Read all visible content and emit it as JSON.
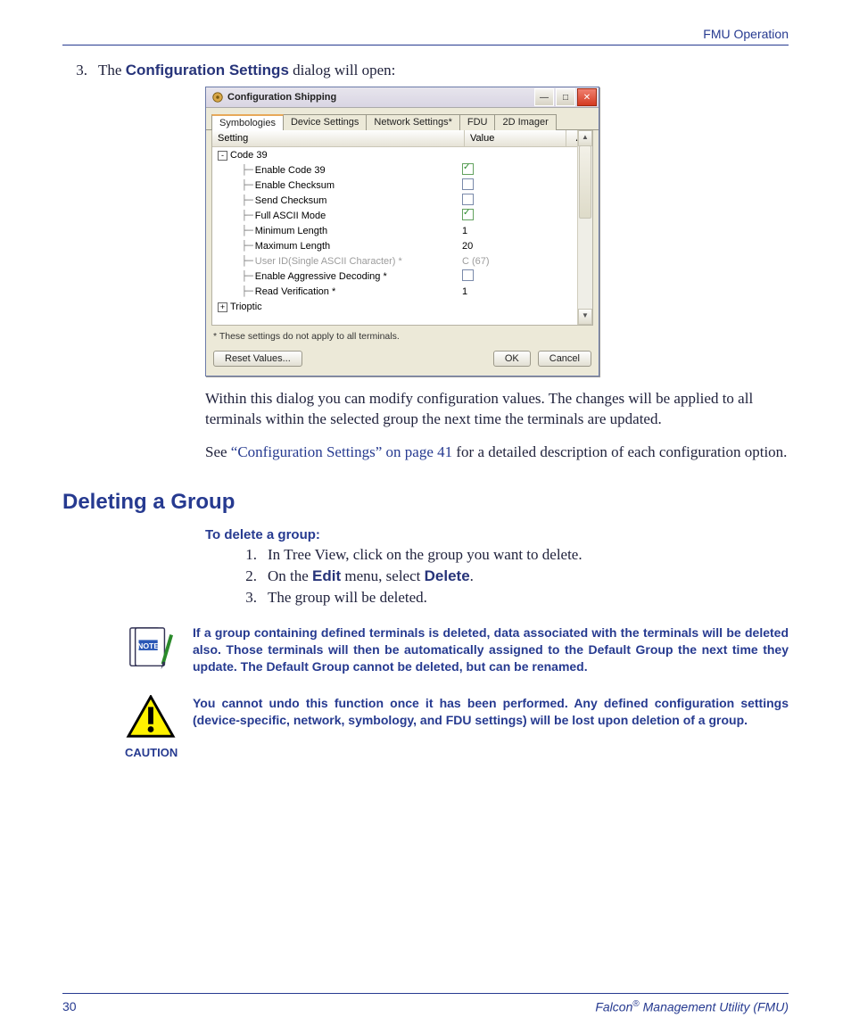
{
  "header": {
    "section": "FMU Operation"
  },
  "intro": {
    "step_num": "3.",
    "step_text_pre": "The ",
    "step_bold": "Configuration Settings",
    "step_text_post": " dialog will open:"
  },
  "dialog": {
    "title": "Configuration Shipping",
    "tabs": [
      "Symbologies",
      "Device Settings",
      "Network Settings*",
      "FDU",
      "2D Imager"
    ],
    "active_tab": 0,
    "columns": {
      "setting": "Setting",
      "value": "Value",
      "scrollhead": "▲"
    },
    "rows": [
      {
        "label": "Code 39",
        "indent": 0,
        "expander": "-",
        "value": ""
      },
      {
        "label": "Enable Code 39",
        "indent": 1,
        "value": "check-on"
      },
      {
        "label": "Enable Checksum",
        "indent": 1,
        "value": "check-off"
      },
      {
        "label": "Send Checksum",
        "indent": 1,
        "value": "check-off"
      },
      {
        "label": "Full ASCII Mode",
        "indent": 1,
        "value": "check-on"
      },
      {
        "label": "Minimum Length",
        "indent": 1,
        "value": "1"
      },
      {
        "label": "Maximum Length",
        "indent": 1,
        "value": "20"
      },
      {
        "label": "User ID(Single ASCII Character) *",
        "indent": 1,
        "value": "C (67)",
        "disabled": true
      },
      {
        "label": "Enable Aggressive Decoding *",
        "indent": 1,
        "value": "check-off"
      },
      {
        "label": "Read Verification *",
        "indent": 1,
        "value": "1"
      },
      {
        "label": "Trioptic",
        "indent": 0,
        "expander": "+",
        "value": ""
      }
    ],
    "footnote": "* These settings do not apply to all terminals.",
    "buttons": {
      "reset": "Reset Values...",
      "ok": "OK",
      "cancel": "Cancel"
    }
  },
  "para1": "Within this dialog you can modify configuration values. The changes will be applied to all terminals within the selected group the next time the terminals are updated.",
  "para2_pre": "See ",
  "para2_link": "“Configuration Settings” on page 41",
  "para2_post": " for a detailed description of each configuration option.",
  "section_heading": "Deleting a Group",
  "delete": {
    "subhead": "To delete a group:",
    "steps": [
      {
        "n": "1.",
        "t": "In Tree View, click on the group you want to delete."
      },
      {
        "n": "2.",
        "pre": "On the ",
        "b1": "Edit",
        "mid": " menu, select ",
        "b2": "Delete",
        "post": "."
      },
      {
        "n": "3.",
        "t": "The group will be deleted."
      }
    ]
  },
  "note_text": "If a group containing defined terminals is deleted, data associated with the terminals will be deleted also. Those terminals will then be automatically assigned to the Default Group the next time they update. The Default Group cannot be deleted, but can be renamed.",
  "caution_label": "CAUTION",
  "caution_text": "You cannot undo this function once it has been performed. Any defined configuration settings (device-specific, network, symbology, and FDU settings) will be lost upon deletion of a group.",
  "footer": {
    "page": "30",
    "product_pre": "Falcon",
    "product_post": " Management Utility (FMU)",
    "reg": "®"
  }
}
